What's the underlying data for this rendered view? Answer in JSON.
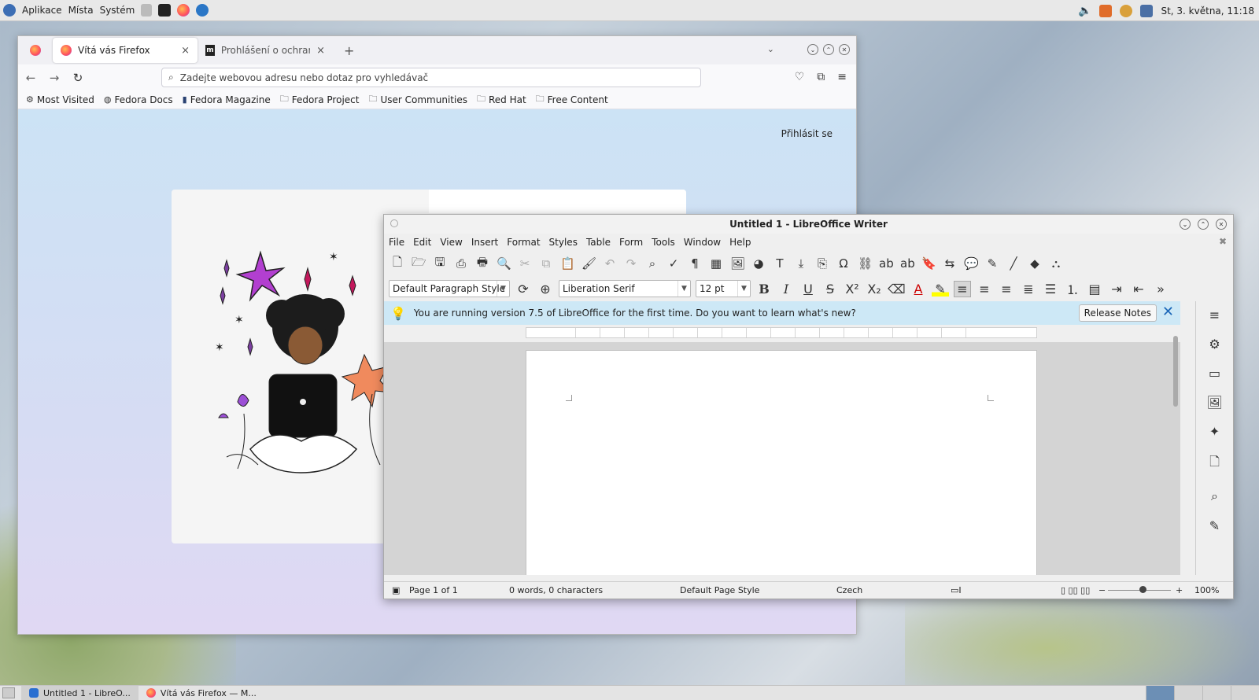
{
  "top_panel": {
    "menus": [
      "Aplikace",
      "Místa",
      "Systém"
    ],
    "clock": "St, 3. května, 11:18"
  },
  "firefox": {
    "tabs": [
      {
        "label": "Vítá vás Firefox",
        "close": "×"
      },
      {
        "label": "Prohlášení o ochraně osob",
        "close": "×"
      }
    ],
    "new_tab": "+",
    "url_placeholder": "Zadejte webovou adresu nebo dotaz pro vyhledávač",
    "bookmarks": [
      "Most Visited",
      "Fedora Docs",
      "Fedora Magazine",
      "Fedora Project",
      "User Communities",
      "Red Hat",
      "Free Content"
    ],
    "signin": "Přihlásit se"
  },
  "writer": {
    "title": "Untitled 1 - LibreOffice Writer",
    "menus": [
      "File",
      "Edit",
      "View",
      "Insert",
      "Format",
      "Styles",
      "Table",
      "Form",
      "Tools",
      "Window",
      "Help"
    ],
    "paragraph_style": "Default Paragraph Style",
    "font_name": "Liberation Serif",
    "font_size": "12 pt",
    "infobar_text": "You are running version 7.5 of LibreOffice for the first time. Do you want to learn what's new?",
    "release_notes": "Release Notes",
    "status": {
      "page": "Page 1 of 1",
      "words": "0 words, 0 characters",
      "page_style": "Default Page Style",
      "language": "Czech",
      "zoom": "100%"
    }
  },
  "taskbar": {
    "tasks": [
      "Untitled 1 - LibreO...",
      "Vítá vás Firefox — M..."
    ]
  }
}
